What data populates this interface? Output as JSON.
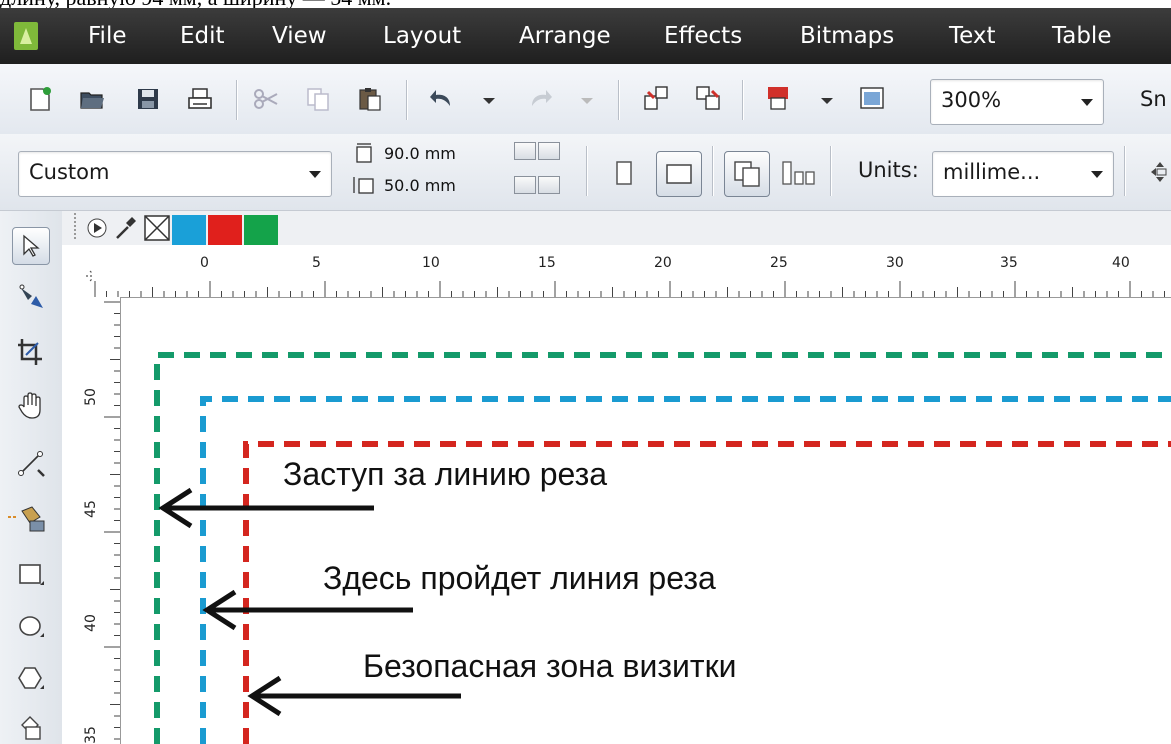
{
  "cropped_header_text": "длину, равную 94 мм, а ширину — 54 мм.",
  "menu": {
    "items": [
      "File",
      "Edit",
      "View",
      "Layout",
      "Arrange",
      "Effects",
      "Bitmaps",
      "Text",
      "Table"
    ]
  },
  "toolbar": {
    "zoom_value": "300%",
    "snap_label": "Sn"
  },
  "property_bar": {
    "page_preset": "Custom",
    "width_value": "90.0 mm",
    "height_value": "50.0 mm",
    "units_label": "Units:",
    "units_value": "millime..."
  },
  "palette": {
    "colors": [
      "#1aa0d8",
      "#e0201c",
      "#14a34a"
    ]
  },
  "rulers": {
    "horizontal_ticks": [
      "0",
      "5",
      "10",
      "15",
      "20",
      "25",
      "30",
      "35",
      "40"
    ],
    "vertical_ticks": [
      "50",
      "45",
      "40",
      "35"
    ]
  },
  "annotations": {
    "bleed": "Заступ за линию реза",
    "cut_line": "Здесь пройдет линия реза",
    "safe_zone": "Безопасная зона визитки"
  },
  "colors": {
    "bleed_line": "#149a6a",
    "cut_line": "#1a9bd1",
    "safe_line": "#d4261f"
  }
}
